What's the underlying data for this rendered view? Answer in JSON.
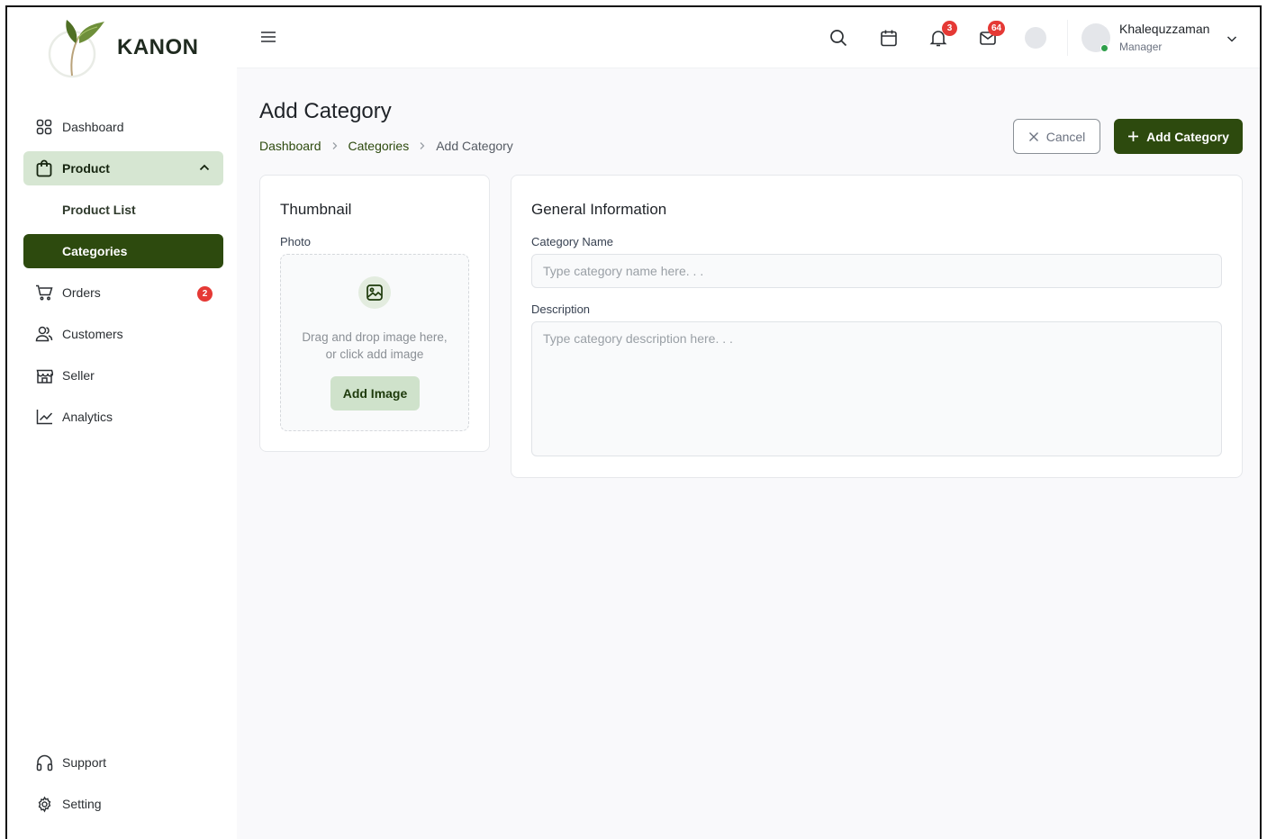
{
  "brand": {
    "name": "KANON"
  },
  "colors": {
    "primary": "#2d4a0e",
    "primary_soft": "#d6e6d2",
    "danger": "#e53935",
    "online": "#2e9e4a"
  },
  "sidebar": {
    "items": [
      {
        "label": "Dashboard",
        "icon": "grid-icon"
      },
      {
        "label": "Product",
        "icon": "shopping-bag-icon",
        "expanded": true,
        "children": [
          {
            "label": "Product List"
          },
          {
            "label": "Categories",
            "active": true
          }
        ]
      },
      {
        "label": "Orders",
        "icon": "cart-icon",
        "badge": "2"
      },
      {
        "label": "Customers",
        "icon": "users-icon"
      },
      {
        "label": "Seller",
        "icon": "store-icon"
      },
      {
        "label": "Analytics",
        "icon": "chart-line-icon"
      }
    ],
    "bottom": [
      {
        "label": "Support",
        "icon": "headset-icon"
      },
      {
        "label": "Setting",
        "icon": "gear-icon"
      }
    ]
  },
  "topbar": {
    "notifications_count": "3",
    "messages_count": "64",
    "user": {
      "name": "Khalequzzaman",
      "role": "Manager"
    }
  },
  "page": {
    "title": "Add Category",
    "breadcrumb": [
      "Dashboard",
      "Categories",
      "Add Category"
    ],
    "cancel_label": "Cancel",
    "add_label": "Add Category"
  },
  "thumbnail": {
    "title": "Thumbnail",
    "photo_label": "Photo",
    "drop_text_1": "Drag and drop image here,",
    "drop_text_2": "or click add image",
    "add_image_label": "Add Image"
  },
  "general": {
    "title": "General Information",
    "name_label": "Category Name",
    "name_placeholder": "Type category name here. . .",
    "name_value": "",
    "description_label": "Description",
    "description_placeholder": "Type category description here. . .",
    "description_value": ""
  }
}
